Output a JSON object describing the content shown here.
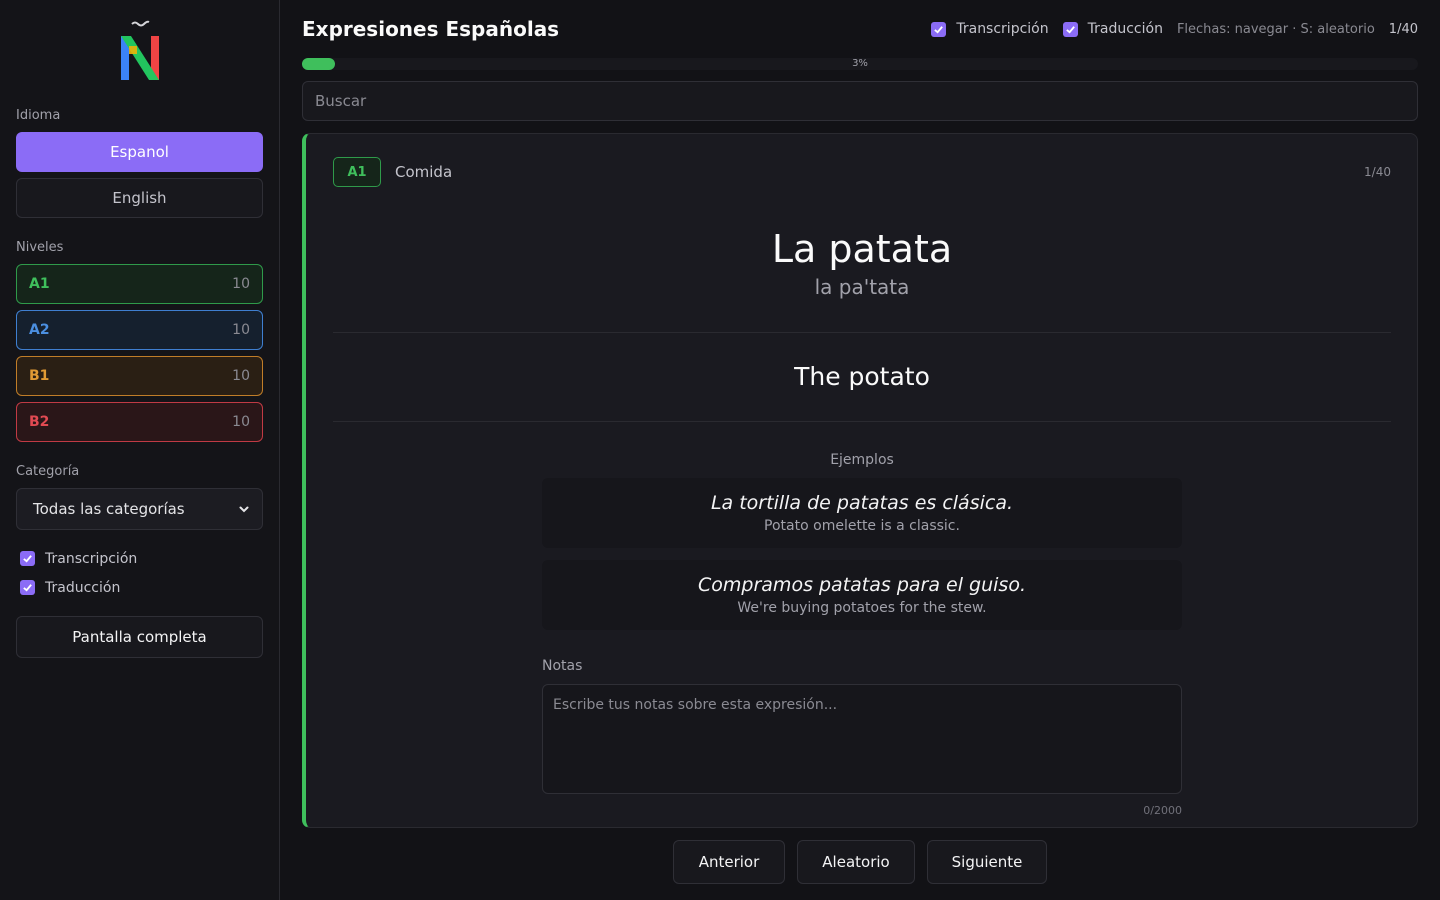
{
  "app": {
    "title": "Expresiones Españolas"
  },
  "sidebar": {
    "language_label": "Idioma",
    "languages": [
      {
        "label": "Espanol",
        "active": true
      },
      {
        "label": "English",
        "active": false
      }
    ],
    "levels_label": "Niveles",
    "levels": [
      {
        "code": "A1",
        "count": "10",
        "color": "#3fbf5c"
      },
      {
        "code": "A2",
        "count": "10",
        "color": "#4b8fe0"
      },
      {
        "code": "B1",
        "count": "10",
        "color": "#e09a34"
      },
      {
        "code": "B2",
        "count": "10",
        "color": "#e04a52"
      }
    ],
    "category_label": "Categoría",
    "category_selected": "Todas las categorías",
    "checkboxes": [
      {
        "label": "Transcripción",
        "checked": true
      },
      {
        "label": "Traducción",
        "checked": true
      }
    ],
    "fullscreen_label": "Pantalla completa"
  },
  "topbar": {
    "transcription_label": "Transcripción",
    "translation_label": "Traducción",
    "hint": "Flechas: navegar · S: aleatorio",
    "counter": "1/40"
  },
  "progress": {
    "percent": 3,
    "label": "3%"
  },
  "search": {
    "placeholder": "Buscar",
    "value": ""
  },
  "card": {
    "level": "A1",
    "category": "Comida",
    "counter": "1/40",
    "expression": "La patata",
    "phonetic": "la pa'tata",
    "translation": "The potato",
    "examples_label": "Ejemplos",
    "examples": [
      {
        "es": "La tortilla de patatas es clásica.",
        "en": "Potato omelette is a classic."
      },
      {
        "es": "Compramos patatas para el guiso.",
        "en": "We're buying potatoes for the stew."
      }
    ],
    "notes_label": "Notas",
    "notes_placeholder": "Escribe tus notas sobre esta expresión...",
    "notes_count": "0/2000"
  },
  "nav": {
    "prev": "Anterior",
    "random": "Aleatorio",
    "next": "Siguiente"
  },
  "colors": {
    "accent": "#8b6cf6",
    "success": "#3fbf5c",
    "background": "#121216"
  }
}
